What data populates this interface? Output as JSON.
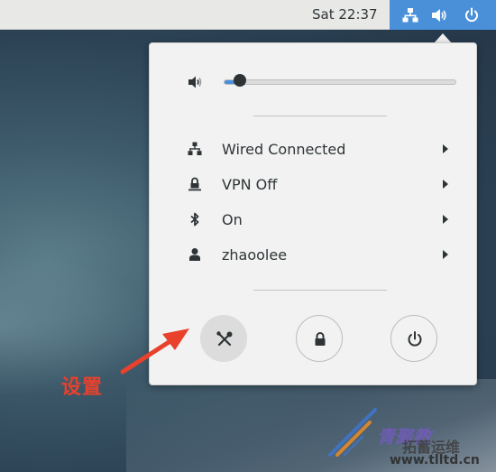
{
  "top_bar": {
    "clock": "Sat 22:37",
    "tray_icons": [
      "network-wired-icon",
      "volume-icon",
      "power-icon"
    ],
    "tray_color": "#4a90d9"
  },
  "popup": {
    "volume": {
      "icon": "volume-low-icon",
      "level": 0.07
    },
    "items": [
      {
        "icon": "network-wired-icon",
        "label": "Wired Connected"
      },
      {
        "icon": "vpn-lock-icon",
        "label": "VPN Off"
      },
      {
        "icon": "bluetooth-icon",
        "label": "On"
      },
      {
        "icon": "user-icon",
        "label": "zhaoolee"
      }
    ],
    "buttons": [
      {
        "icon": "settings-tools-icon",
        "role": "settings"
      },
      {
        "icon": "lock-icon",
        "role": "lock"
      },
      {
        "icon": "power-icon",
        "role": "power"
      }
    ]
  },
  "annotation": {
    "label": "设置",
    "color": "#e8412c"
  },
  "watermark": {
    "text1": "青聚教",
    "text2": "拓蓄运维",
    "url": "www.tlltd.cn"
  }
}
